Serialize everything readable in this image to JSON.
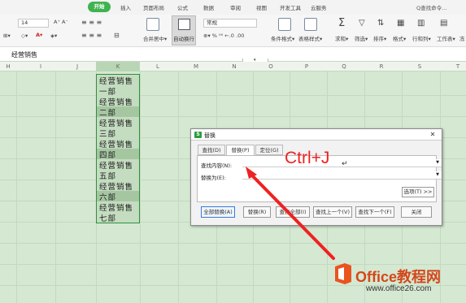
{
  "menu": {
    "active": "开始",
    "items": [
      "插入",
      "页面布局",
      "公式",
      "数据",
      "审阅",
      "视图",
      "开发工具",
      "云服务"
    ],
    "search": "Q查找命令..."
  },
  "toolbar": {
    "font_size": "14",
    "number_format": "常规",
    "merge_label": "合并居中▾",
    "wrap_label": "自动换行",
    "cond_format": "条件格式▾",
    "table_style": "表格样式▾",
    "sum": "求和▾",
    "filter": "筛选▾",
    "sort": "排序▾",
    "format": "格式▾",
    "rowcol": "行和列▾",
    "worksheet": "工作表▾",
    "more": "冻"
  },
  "formula_bar": {
    "content": "经营销售"
  },
  "columns": [
    "H",
    "I",
    "J",
    "K",
    "L",
    "M",
    "N",
    "O",
    "P",
    "Q",
    "R",
    "S",
    "T"
  ],
  "cells": [
    "经营销售",
    "一部",
    "经营销售",
    "二部",
    "经营销售",
    "三部",
    "经营销售",
    "四部",
    "经营销售",
    "五部",
    "经营销售",
    "六部",
    "经营销售",
    "七部"
  ],
  "dialog": {
    "title": "替换",
    "tabs": [
      "查找(D)",
      "替换(P)",
      "定位(G)"
    ],
    "find_label": "查找内容(N):",
    "replace_label": "替换为(E):",
    "options_button": "选项(T) >>",
    "buttons": [
      "全部替换(A)",
      "替换(R)",
      "查找全部(I)",
      "查找上一个(V)",
      "查找下一个(F)",
      "关闭"
    ]
  },
  "overlay": {
    "shortcut": "Ctrl+J",
    "cursor_mark": "↵"
  },
  "watermark": {
    "brand": "Office教程网",
    "url": "www.office26.com"
  },
  "colors": {
    "accent": "#3fb34f",
    "grid_bg": "#d5e8d2",
    "selection_border": "#2f8f3e",
    "annotation": "#ee2222",
    "logo": "#d4471b"
  }
}
